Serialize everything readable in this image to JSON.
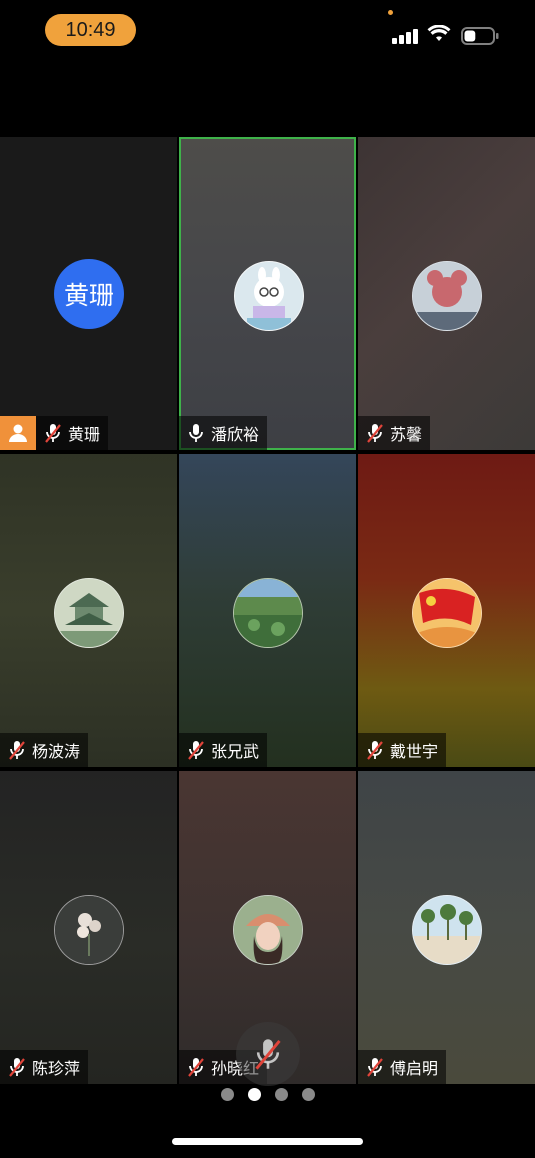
{
  "status_bar": {
    "time": "10:49",
    "battery_level": 0.4
  },
  "participants": [
    {
      "name": "黄珊",
      "avatar_text": "黄珊",
      "avatar_type": "initials",
      "mic": "muted",
      "host": true,
      "active": false
    },
    {
      "name": "潘欣裕",
      "avatar_type": "cartoon-bunny-photo",
      "mic": "on",
      "host": false,
      "active": true
    },
    {
      "name": "苏馨",
      "avatar_type": "balloon-photo",
      "mic": "muted",
      "host": false,
      "active": false
    },
    {
      "name": "杨波涛",
      "avatar_type": "pavilion-painting",
      "mic": "muted",
      "host": false,
      "active": false
    },
    {
      "name": "张兄武",
      "avatar_type": "lotus-pond-photo",
      "mic": "muted",
      "host": false,
      "active": false
    },
    {
      "name": "戴世宇",
      "avatar_type": "red-flag-image",
      "mic": "muted",
      "host": false,
      "active": false
    },
    {
      "name": "陈珍萍",
      "avatar_type": "flowers-photo",
      "mic": "muted",
      "host": false,
      "active": false
    },
    {
      "name": "孙晓红",
      "avatar_type": "portrait-photo",
      "mic": "muted",
      "host": false,
      "active": false
    },
    {
      "name": "傅启明",
      "avatar_type": "palm-trees-photo",
      "mic": "muted",
      "host": false,
      "active": false
    }
  ],
  "pagination": {
    "total": 4,
    "current": 2
  },
  "colors": {
    "accent": "#f0a23c",
    "active_border": "#3fb24a",
    "initials_bg": "#2f6ef0",
    "mute_slash": "#e0443a"
  }
}
